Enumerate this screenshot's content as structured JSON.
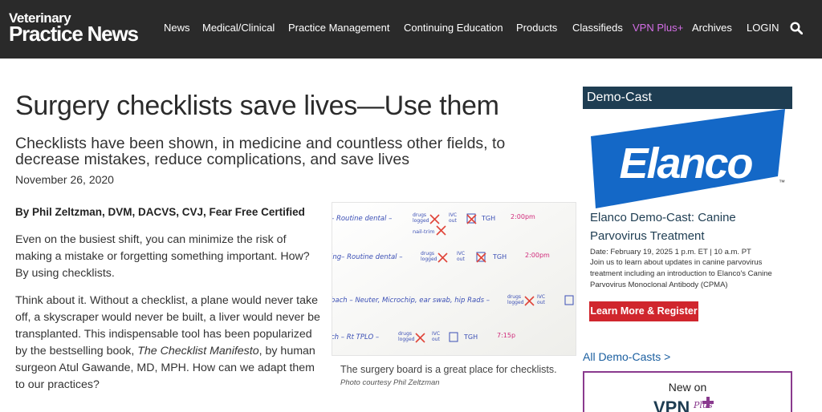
{
  "brand": {
    "line1": "Veterinary",
    "line2": "Practice News"
  },
  "nav": {
    "items": [
      "News",
      "Medical/Clinical",
      "Practice Management",
      "Continuing Education",
      "Products",
      "Classifieds",
      "VPN Plus+",
      "Archives",
      "LOGIN"
    ],
    "accent_color": "#d46ee6"
  },
  "article": {
    "title": "Surgery checklists save lives—Use them",
    "subtitle": "Checklists have been shown, in medicine and countless other fields, to decrease mistakes, reduce complications, and save lives",
    "date": "November 26, 2020",
    "byline": "By Phil Zeltzman, DVM, DACVS, CVJ, Fear Free Certified",
    "p1": "Even on the busiest shift, you can minimize the risk of making a mistake or forgetting something important. How? By using checklists.",
    "p2_before": "Think about it. Without a checklist, a plane would never take off, a skyscraper would never be built, a liver would never be transplanted. This indispensable tool has been popularized by the bestselling book, ",
    "p2_book": "The Checklist Manifesto",
    "p2_after": ", by human surgeon Atul Gawande, MD, MPH. How can we adapt them to our practices?",
    "caption": "The surgery board is a great place for checklists.",
    "credit": "Photo courtesy Phil Zeltzman"
  },
  "board": {
    "rows": [
      {
        "task": "– Routine dental –",
        "drugs": "drugs logged",
        "cat": "IVC out",
        "tgh": "TGH",
        "time": "2:00pm",
        "extra": "nail-trim"
      },
      {
        "task": "ing– Routine dental –",
        "drugs": "drugs logged",
        "cat": "IVC out",
        "tgh": "TGH",
        "time": "2:00pm",
        "extra": ""
      },
      {
        "task": "bach – Neuter, Microchip, ear swab, hip Rads –",
        "drugs": "drugs logged",
        "cat": "IVC out",
        "tgh": "",
        "time": "",
        "extra": ""
      },
      {
        "task": "ch – Rt TPLO –",
        "drugs": "drugs logged",
        "cat": "IVC out",
        "tgh": "TGH",
        "time": "7:15p",
        "extra": ""
      }
    ],
    "ink_color": "#3b4fb5",
    "mark_color": "#e0453a",
    "time_color": "#d02a7a"
  },
  "sidebar": {
    "section_title": "Demo-Cast",
    "logo_text": "Elanco",
    "logo_tm": "™",
    "brand_blue": "#1468c7",
    "event_title": "Elanco Demo-Cast: Canine Parvovirus Treatment",
    "event_date": "Date: February 19, 2025 1 p.m. ET | 10 a.m. PT",
    "event_desc": "Join us to learn about updates in canine parvovirus treatment including an introduction to Elanco's Canine Parvovirus Monoclonal Antibody (CPMA)",
    "cta_label": "Learn More & Register",
    "cta_color": "#d0262d",
    "all_link": "All Demo-Casts >",
    "vpn_new": "New on",
    "vpn_logo_text": "VPN",
    "vpn_logo_script": "Plus"
  },
  "icons": {
    "search": "search-icon"
  }
}
